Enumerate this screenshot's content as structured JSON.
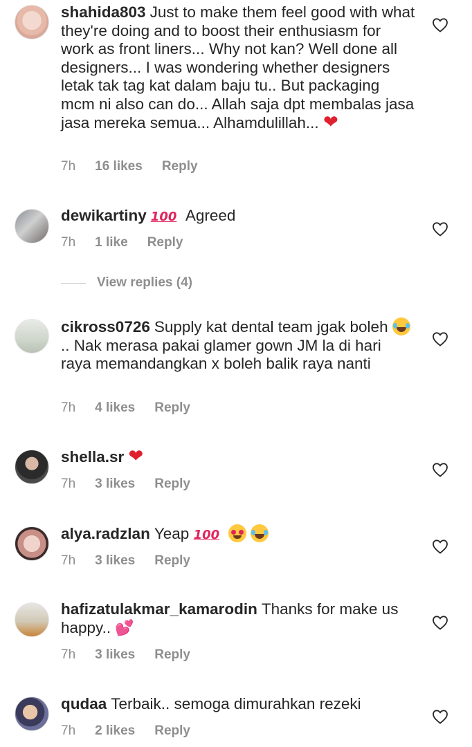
{
  "comments": [
    {
      "username": "shahida803",
      "text": "Just to make them feel good with what they're doing and to boost their enthusiasm for work as front liners... Why not kan? Well done all designers... I was wondering whether designers letak tak tag kat dalam baju tu.. But packaging mcm ni also can do... Allah saja dpt membalas jasa jasa mereka semua... Alhamdulillah...",
      "emoji": "red-heart",
      "time": "7h",
      "likes": "16 likes",
      "reply": "Reply"
    },
    {
      "username": "dewikartiny",
      "emoji": "hundred-points",
      "text": "Agreed",
      "time": "7h",
      "likes": "1 like",
      "reply": "Reply",
      "view_replies": "View replies (4)"
    },
    {
      "username": "cikross0726",
      "text_before": "Supply kat dental team jgak boleh",
      "emoji": "face-with-tears-of-joy",
      "text_after": ".. Nak merasa pakai glamer gown JM la di hari raya memandangkan x boleh balik raya nanti",
      "time": "7h",
      "likes": "4 likes",
      "reply": "Reply"
    },
    {
      "username": "shella.sr",
      "emoji": "red-heart",
      "time": "7h",
      "likes": "3 likes",
      "reply": "Reply"
    },
    {
      "username": "alya.radzlan",
      "text": "Yeap",
      "emojis": [
        "hundred-points",
        "smiling-face-with-heart-eyes",
        "face-with-tears-of-joy"
      ],
      "time": "7h",
      "likes": "3 likes",
      "reply": "Reply"
    },
    {
      "username": "hafizatulakmar_kamarodin",
      "text": "Thanks for make us happy..",
      "emoji": "two-hearts",
      "time": "7h",
      "likes": "3 likes",
      "reply": "Reply"
    },
    {
      "username": "qudaa",
      "text": "Terbaik.. semoga dimurahkan rezeki",
      "time": "7h",
      "likes": "2 likes",
      "reply": "Reply"
    }
  ],
  "glyphs": {
    "hundred": "100",
    "red_heart": "❤",
    "two_hearts": "💕"
  },
  "colors": {
    "text": "#262626",
    "meta": "#8e8e8e",
    "background": "#ffffff"
  }
}
